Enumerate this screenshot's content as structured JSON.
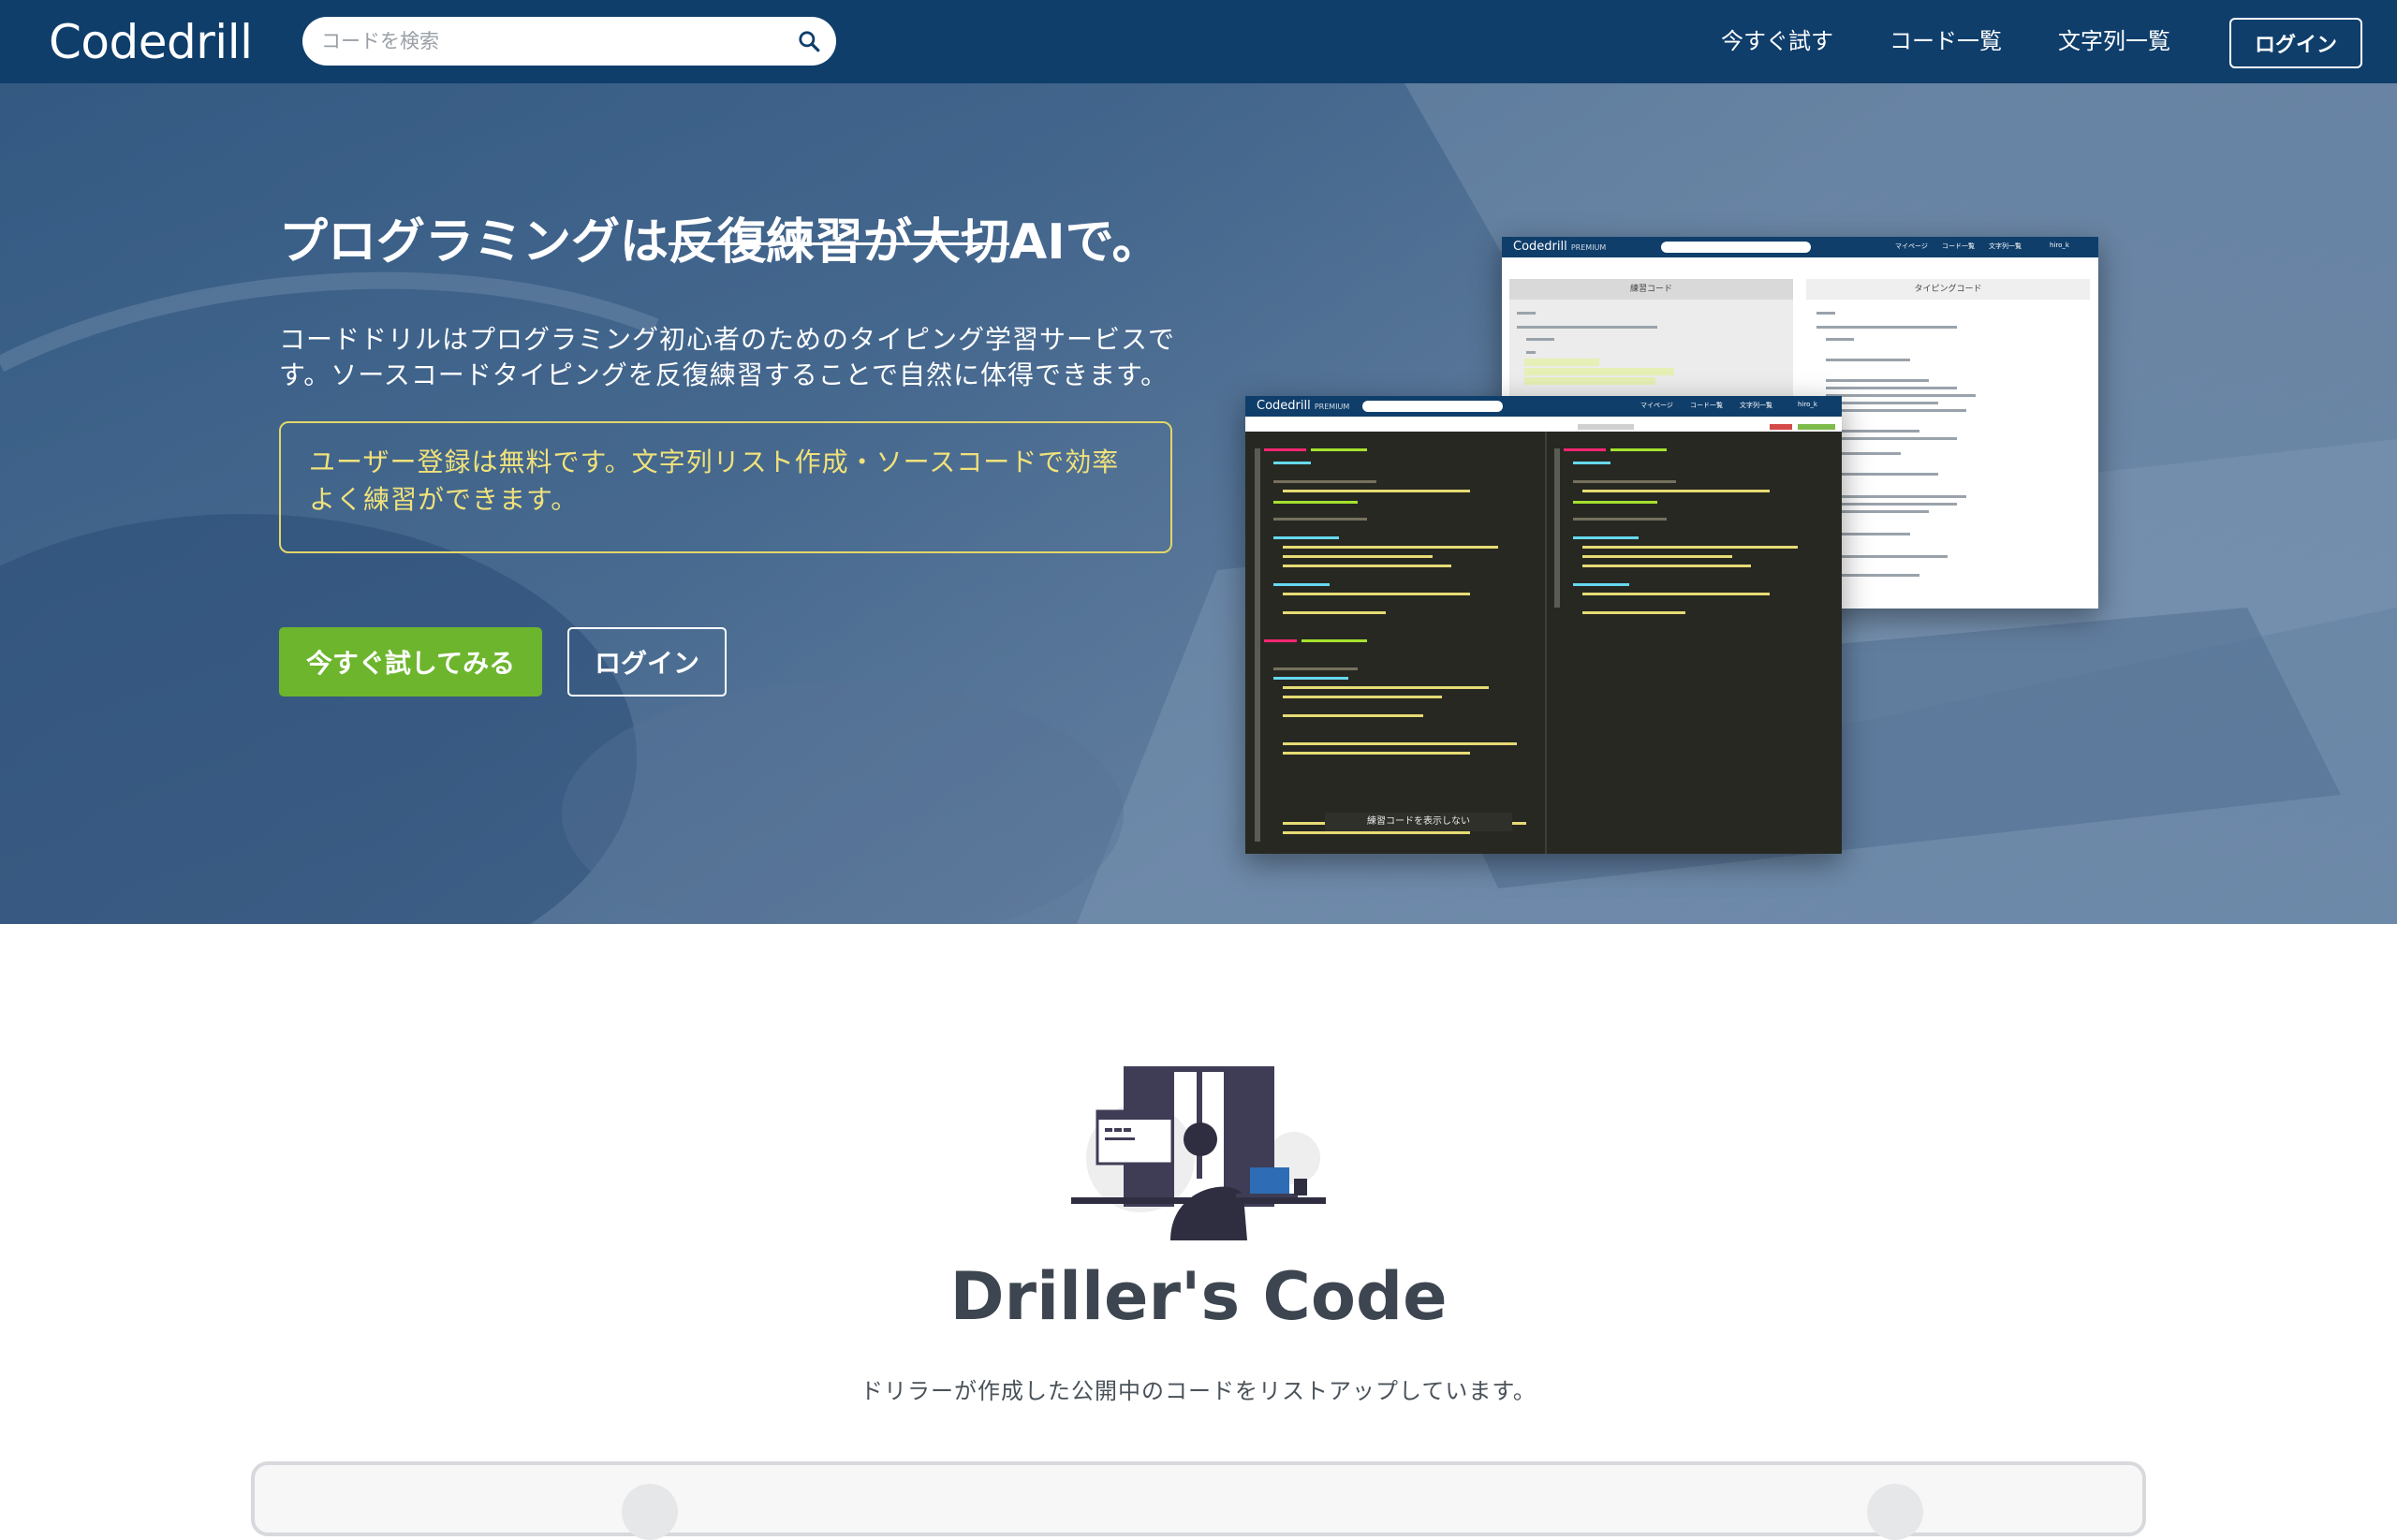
{
  "navbar": {
    "logo": "Codedrill",
    "search_placeholder": "コードを検索",
    "links": [
      {
        "label": "今すぐ試す"
      },
      {
        "label": "コード一覧"
      },
      {
        "label": "文字列一覧"
      }
    ],
    "login_label": "ログイン"
  },
  "hero": {
    "title_prefix": "プログラミングは",
    "title_struck": "反復練習が大切",
    "title_suffix": "AIで。",
    "description": "コードドリルはプログラミング初心者のためのタイピング学習サービスです。ソースコードタイピングを反復練習することで自然に体得できます。",
    "notice": "ユーザー登録は無料です。文字列リスト作成・ソースコードで効率よく練習ができます。",
    "try_button": "今すぐ試してみる",
    "login_button": "ログイン"
  },
  "preview_back": {
    "logo": "Codedrill",
    "logo_badge": "PREMIUM",
    "nav_items": [
      "マイページ",
      "コード一覧",
      "文字列一覧",
      "hiro_k"
    ],
    "left_pane_title": "練習コード",
    "right_pane_title": "タイピングコード"
  },
  "preview_front": {
    "logo": "Codedrill",
    "logo_badge": "PREMIUM",
    "nav_items": [
      "マイページ",
      "コード一覧",
      "文字列一覧",
      "hiro_k"
    ],
    "toggle_label": "練習コードを表示しない"
  },
  "section": {
    "title": "Driller's Code",
    "subtitle": "ドリラーが作成した公開中のコードをリストアップしています。"
  },
  "colors": {
    "navbar": "#0f3e6b",
    "accent_green": "#6cb52d",
    "notice_yellow": "#f0e27a",
    "section_title": "#3d4650"
  }
}
